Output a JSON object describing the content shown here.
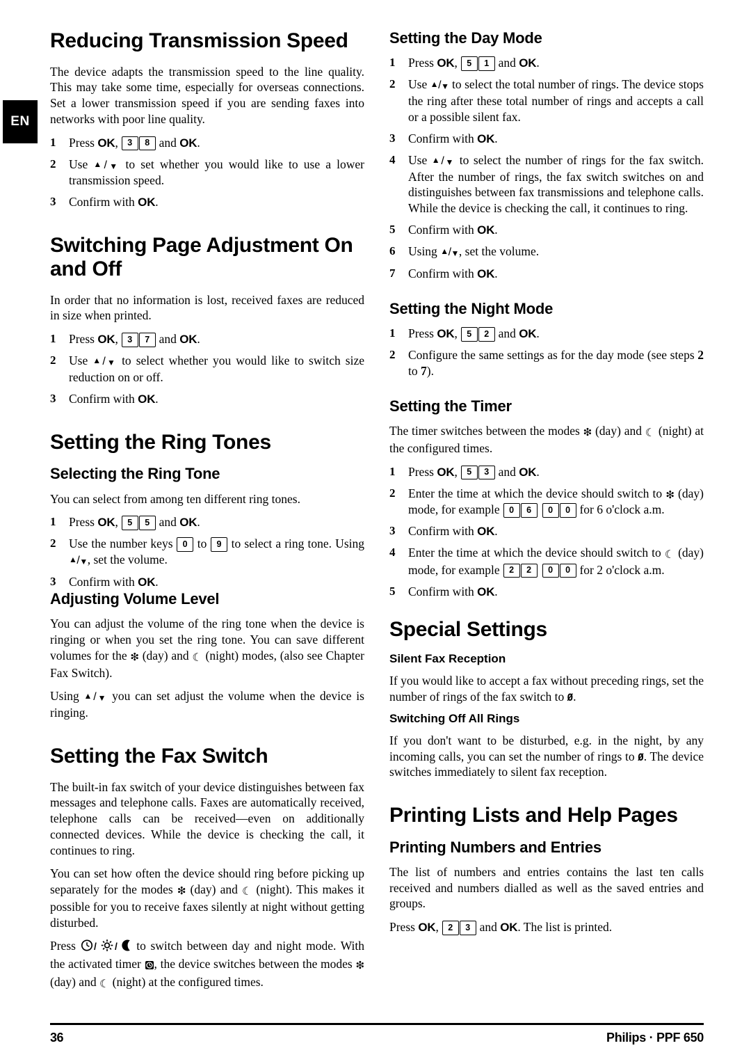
{
  "page": {
    "language_tab": "EN",
    "footer": {
      "page_number": "36",
      "brand": "Philips · PPF 650"
    }
  },
  "glyphs": {
    "day_symbol": "day-mode-sun-icon",
    "night_symbol": "night-mode-moon-icon",
    "timer_symbol": "timer-clock-icon",
    "up_down_keys": "up-down-arrow-keys",
    "zero_key": "slashed-zero-icon"
  },
  "left_column": {
    "s1": {
      "heading": "Reducing Transmission Speed",
      "intro": "The device adapts the transmission speed to the line quality. This may take some time, especially for overseas connections. Set a lower transmission speed if you are sending faxes into networks with poor line quality.",
      "steps": [
        {
          "n": "1",
          "pre": "Press ",
          "ok1": "OK",
          "mid": ", ",
          "keys": [
            "3",
            "8"
          ],
          "post": " and ",
          "ok2": "OK",
          "end": "."
        },
        {
          "n": "2",
          "text_a": "Use ",
          "text_b": " to set whether you would like to use a lower transmission speed."
        },
        {
          "n": "3",
          "pre": "Confirm with ",
          "ok1": "OK",
          "end": "."
        }
      ]
    },
    "s2": {
      "heading": "Switching Page Adjustment On and Off",
      "intro": "In order that no information is lost, received faxes are reduced in size when printed.",
      "steps": [
        {
          "n": "1",
          "pre": "Press ",
          "ok1": "OK",
          "mid": ", ",
          "keys": [
            "3",
            "7"
          ],
          "post": " and ",
          "ok2": "OK",
          "end": "."
        },
        {
          "n": "2",
          "text_a": "Use ",
          "text_b": " to select whether you would like to switch size reduction on or off."
        },
        {
          "n": "3",
          "pre": "Confirm with ",
          "ok1": "OK",
          "end": "."
        }
      ]
    },
    "s3": {
      "heading": "Setting the Ring Tones",
      "sub1": {
        "heading": "Selecting the Ring Tone",
        "intro": "You can select from among ten different ring tones.",
        "steps": [
          {
            "n": "1",
            "pre": "Press ",
            "ok1": "OK",
            "mid": ", ",
            "keys": [
              "5",
              "5"
            ],
            "post": " and ",
            "ok2": "OK",
            "end": "."
          },
          {
            "n": "2",
            "a": "Use the number keys ",
            "k1": "0",
            "b": " to ",
            "k2": "9",
            "c": " to select a ring tone. Using ",
            "d": ", set the volume."
          },
          {
            "n": "3",
            "pre": "Confirm with ",
            "ok1": "OK",
            "end": "."
          }
        ]
      },
      "sub2": {
        "heading": "Adjusting Volume Level",
        "para1_a": "You can adjust the volume of the ring tone when the device is ringing or when you set the ring tone. You can save different volumes for the ",
        "para1_b": " (day) and ",
        "para1_c": " (night) modes, (also see Chapter Fax Switch).",
        "para2_a": "Using ",
        "para2_b": " you can set adjust the volume when the device is ringing."
      }
    },
    "s4": {
      "heading": "Setting the Fax Switch",
      "para1": "The built-in fax switch of your device distinguishes between fax messages and telephone calls. Faxes are automatically received, telephone calls can be received—even on additionally connected devices. While the device is checking the call, it continues to ring.",
      "para2_a": "You can set how often the device should ring before picking up separately for the modes ",
      "para2_b": " (day) and ",
      "para2_c": " (night). This makes it possible for you to receive faxes silently at night without getting disturbed.",
      "para3_a": "Press ",
      "para3_b": " to switch between day and night mode. With the activated timer ",
      "para3_c": ", the device switches between the modes ",
      "para3_d": " (day) and ",
      "para3_e": " (night) at the configured times."
    }
  },
  "right_column": {
    "s5": {
      "heading": "Setting the Day Mode",
      "steps": [
        {
          "n": "1",
          "pre": "Press ",
          "ok1": "OK",
          "mid": ", ",
          "keys": [
            "5",
            "1"
          ],
          "post": " and ",
          "ok2": "OK",
          "end": "."
        },
        {
          "n": "2",
          "text_a": "Use ",
          "text_b": " to select the total number of rings. The device stops the ring after these total number of rings and accepts a call or a possible silent fax."
        },
        {
          "n": "3",
          "pre": "Confirm with ",
          "ok1": "OK",
          "end": "."
        },
        {
          "n": "4",
          "text_a": "Use ",
          "text_b": " to select the number of rings for the fax switch. After the number of rings, the fax switch switches on and distinguishes between fax transmissions and telephone calls. While the device is checking the call, it continues to ring."
        },
        {
          "n": "5",
          "pre": "Confirm with ",
          "ok1": "OK",
          "end": "."
        },
        {
          "n": "6",
          "text_a": "Using ",
          "text_b": ", set the volume."
        },
        {
          "n": "7",
          "pre": "Confirm with ",
          "ok1": "OK",
          "end": "."
        }
      ]
    },
    "s6": {
      "heading": "Setting the Night Mode",
      "steps": [
        {
          "n": "1",
          "pre": "Press ",
          "ok1": "OK",
          "mid": ", ",
          "keys": [
            "5",
            "2"
          ],
          "post": " and ",
          "ok2": "OK",
          "end": "."
        },
        {
          "n": "2",
          "a": "Configure the same settings as for the day mode (see steps ",
          "b": "2",
          "c": " to ",
          "d": "7",
          "e": ")."
        }
      ]
    },
    "s7": {
      "heading": "Setting the Timer",
      "intro_a": "The timer switches between the modes ",
      "intro_b": " (day) and ",
      "intro_c": " (night) at the configured times.",
      "steps": [
        {
          "n": "1",
          "pre": "Press ",
          "ok1": "OK",
          "mid": ", ",
          "keys": [
            "5",
            "3"
          ],
          "post": " and ",
          "ok2": "OK",
          "end": "."
        },
        {
          "n": "2",
          "a": "Enter the time at which the device should switch to ",
          "b": " (day) mode, for example ",
          "keys1": [
            "0",
            "6"
          ],
          "keys2": [
            "0",
            "0"
          ],
          "c": " for 6 o'clock a.m."
        },
        {
          "n": "3",
          "pre": "Confirm with ",
          "ok1": "OK",
          "end": "."
        },
        {
          "n": "4",
          "a": "Enter the time at which the device should switch to ",
          "b": " (day) mode, for example ",
          "keys1": [
            "2",
            "2"
          ],
          "keys2": [
            "0",
            "0"
          ],
          "c": " for 2 o'clock a.m."
        },
        {
          "n": "5",
          "pre": "Confirm with ",
          "ok1": "OK",
          "end": "."
        }
      ]
    },
    "s8": {
      "heading": "Special Settings",
      "sub1": {
        "heading": "Silent Fax Reception",
        "para_a": "If you would like to accept a fax without preceding rings, set the number of rings of the fax switch to ",
        "para_b": "."
      },
      "sub2": {
        "heading": "Switching Off All Rings",
        "para_a": "If you don't want to be disturbed, e.g. in the night, by any incoming calls, you can set the number of rings to ",
        "para_b": ". The device switches immediately to silent fax reception."
      }
    },
    "s9": {
      "heading": "Printing Lists and Help Pages",
      "sub1": {
        "heading": "Printing Numbers and Entries",
        "intro": "The list of numbers and entries contains the last ten calls received and numbers dialled as well as the saved entries and groups.",
        "press_a": "Press ",
        "ok1": "OK",
        "press_b": ", ",
        "keys": [
          "2",
          "3"
        ],
        "press_c": " and ",
        "ok2": "OK",
        "press_d": ". The list is printed."
      }
    }
  }
}
